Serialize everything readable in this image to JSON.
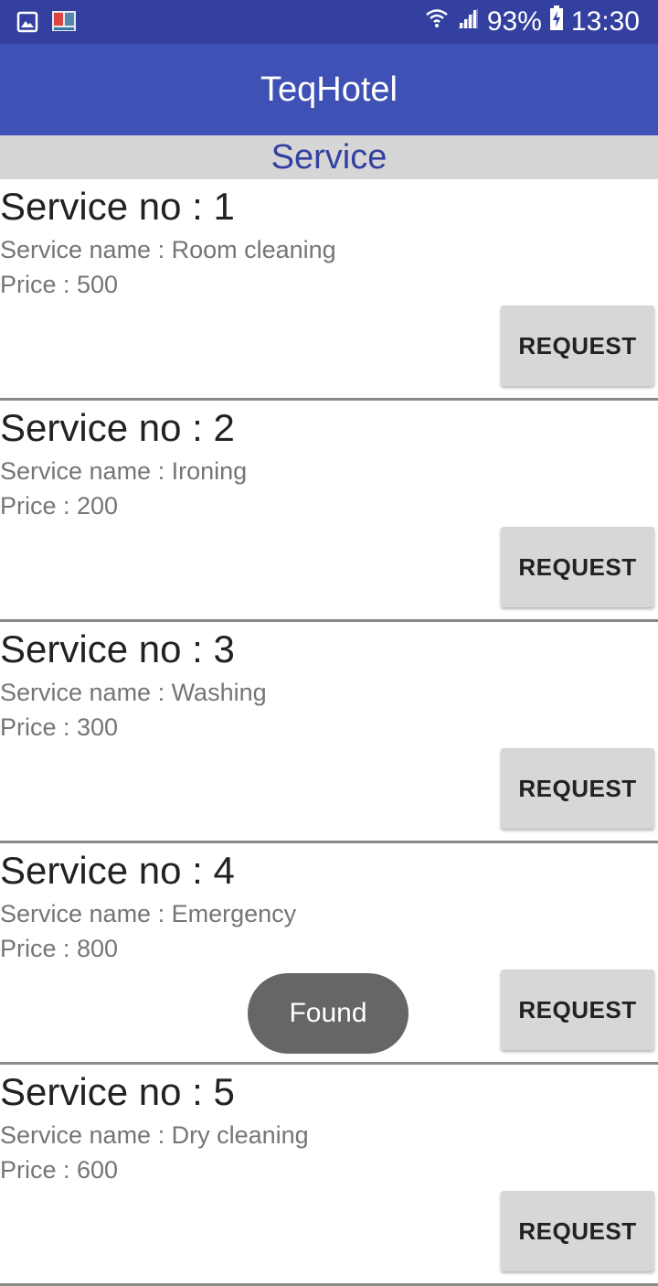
{
  "status_bar": {
    "battery": "93%",
    "time": "13:30",
    "icons": [
      "gallery-icon",
      "book-app-icon",
      "wifi-icon",
      "signal-icon",
      "battery-charging-icon"
    ]
  },
  "app_bar": {
    "title": "TeqHotel"
  },
  "section": {
    "title": "Service"
  },
  "services": [
    {
      "title": "Service no : 1",
      "name": "Service name : Room cleaning",
      "price": "Price : 500",
      "button": "REQUEST"
    },
    {
      "title": "Service no : 2",
      "name": "Service name : Ironing",
      "price": "Price : 200",
      "button": "REQUEST"
    },
    {
      "title": "Service no : 3",
      "name": "Service name : Washing",
      "price": "Price : 300",
      "button": "REQUEST"
    },
    {
      "title": "Service no : 4",
      "name": "Service name : Emergency",
      "price": "Price : 800",
      "button": "REQUEST"
    },
    {
      "title": "Service no : 5",
      "name": "Service name : Dry cleaning",
      "price": "Price : 600",
      "button": "REQUEST"
    }
  ],
  "toast": {
    "text": "Found"
  },
  "colors": {
    "status_bar": "#3340A0",
    "app_bar": "#3F51B5",
    "section_text": "#3340A0",
    "section_bg": "#D6D6D6",
    "button_bg": "#D6D7D7",
    "toast_bg": "#666666"
  }
}
